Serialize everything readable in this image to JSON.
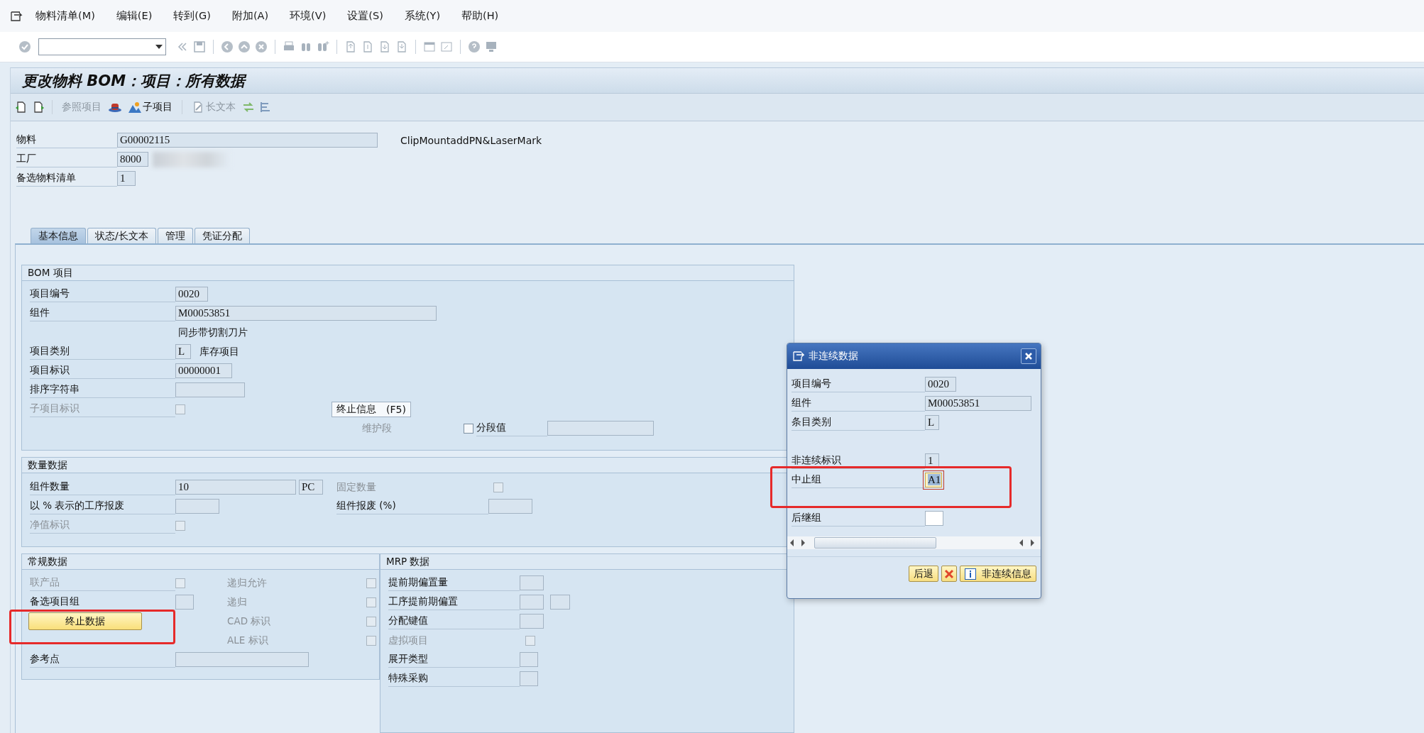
{
  "menu_bar": [
    "物料清单(M)",
    "编辑(E)",
    "转到(G)",
    "附加(A)",
    "环境(V)",
    "设置(S)",
    "系统(Y)",
    "帮助(H)"
  ],
  "title": "更改物料 BOM：项目：所有数据",
  "app_toolbar": [
    {
      "label": "参照项目",
      "disabled": true
    },
    {
      "label": "子项目",
      "disabled": false
    },
    {
      "label": "长文本",
      "disabled": true
    }
  ],
  "header": [
    {
      "label": "物料",
      "value": "G00002115",
      "description": "ClipMountaddPN&LaserMark"
    },
    {
      "label": "工厂",
      "value": "8000"
    },
    {
      "label": "备选物料清单",
      "value": "1"
    }
  ],
  "tabs": [
    {
      "label": "基本信息",
      "selected": true
    },
    {
      "label": "状态/长文本",
      "selected": false
    },
    {
      "label": "管理",
      "selected": false
    },
    {
      "label": "凭证分配",
      "selected": false
    }
  ],
  "bom_item": {
    "title": "BOM 项目",
    "item_number": {
      "label": "项目编号",
      "value": "0020"
    },
    "component": {
      "label": "组件",
      "value": "M00053851",
      "description": "同步带切割刀片"
    },
    "item_category": {
      "label": "项目类别",
      "value": "L",
      "description": "库存项目"
    },
    "item_id": {
      "label": "项目标识",
      "value": "00000001"
    },
    "sort_string": {
      "label": "排序字符串"
    },
    "sub_item_indicator": {
      "label": "子项目标识",
      "checked": false,
      "disabled": true
    },
    "discontinuation_button": {
      "label": "终止信息",
      "shortcut": "(F5)"
    },
    "maintain_segment": {
      "label": "维护段",
      "disabled": true
    },
    "segment_value": {
      "label": "分段值",
      "checked": false,
      "disabled": false
    }
  },
  "quantity": {
    "title": "数量数据",
    "component_qty": {
      "label": "组件数量",
      "value": "10",
      "unit": "PC"
    },
    "fixed_qty": {
      "label": "固定数量",
      "checked": false,
      "disabled": true
    },
    "operation_scrap": {
      "label": "以 % 表示的工序报废"
    },
    "component_scrap": {
      "label": "组件报废 (%)"
    },
    "net_id": {
      "label": "净值标识",
      "checked": false,
      "disabled": true
    }
  },
  "general": {
    "title": "常规数据",
    "co_product": {
      "label": "联产品",
      "checked": false,
      "disabled": true
    },
    "alt_item_group": {
      "label": "备选项目组"
    },
    "discontinuation_data_button": {
      "label": "终止数据"
    },
    "reference_point": {
      "label": "参考点"
    },
    "recursion_allowed": {
      "label": "递归允许",
      "checked": false,
      "disabled": true
    },
    "recursive": {
      "label": "递归",
      "checked": false,
      "disabled": true
    },
    "cad": {
      "label": "CAD 标识",
      "checked": false,
      "disabled": true
    },
    "ale": {
      "label": "ALE 标识",
      "checked": false,
      "disabled": true
    }
  },
  "mrp": {
    "title": "MRP 数据",
    "lead_time_offset": {
      "label": "提前期偏置量"
    },
    "op_lead_time_offset": {
      "label": "工序提前期偏置"
    },
    "distribution_key": {
      "label": "分配键值"
    },
    "phantom": {
      "label": "虚拟项目",
      "checked": false,
      "disabled": true
    },
    "explosion_type": {
      "label": "展开类型"
    },
    "special_procurement": {
      "label": "特殊采购"
    }
  },
  "dialog": {
    "title": "非连续数据",
    "fields": [
      {
        "label": "项目编号",
        "value": "0020",
        "editable": false,
        "focused": false
      },
      {
        "label": "组件",
        "value": "M00053851",
        "editable": false,
        "focused": false
      },
      {
        "label": "条目类别",
        "value": "L",
        "editable": false,
        "focused": false
      },
      {
        "label": "非连续标识",
        "value": "1",
        "editable": false,
        "focused": false
      },
      {
        "label": "中止组",
        "value": "A1",
        "editable": true,
        "focused": true
      },
      {
        "label": "后继组",
        "editable": true,
        "focused": false
      }
    ],
    "buttons": [
      {
        "kind": "text",
        "label": "后退"
      },
      {
        "kind": "cancel"
      },
      {
        "kind": "info",
        "label": "非连续信息"
      }
    ]
  }
}
